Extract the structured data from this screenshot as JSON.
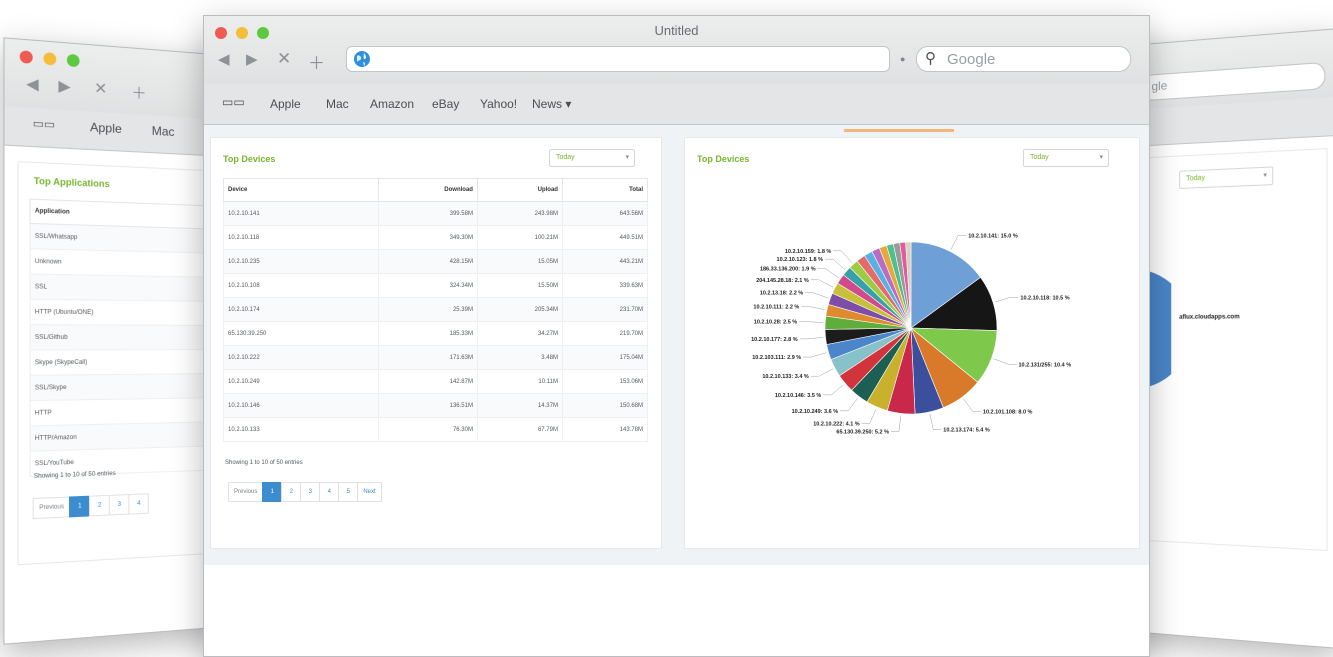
{
  "front": {
    "title": "Untitled",
    "search_placeholder": "Google",
    "bookmarks": [
      "Apple",
      "Mac",
      "Amazon",
      "eBay",
      "Yahoo!",
      "News ▾"
    ],
    "left_panel": {
      "title": "Top Devices",
      "filter": "Today",
      "columns": [
        "Device",
        "Download",
        "Upload",
        "Total"
      ],
      "rows": [
        [
          "10.2.10.141",
          "399.58M",
          "243.98M",
          "643.56M"
        ],
        [
          "10.2.10.118",
          "349.30M",
          "100.21M",
          "449.51M"
        ],
        [
          "10.2.10.235",
          "428.15M",
          "15.05M",
          "443.21M"
        ],
        [
          "10.2.10.108",
          "324.34M",
          "15.50M",
          "339.63M"
        ],
        [
          "10.2.10.174",
          "25.39M",
          "205.34M",
          "231.70M"
        ],
        [
          "65.130.39.250",
          "185.33M",
          "34.27M",
          "219.70M"
        ],
        [
          "10.2.10.222",
          "171.63M",
          "3.48M",
          "175.04M"
        ],
        [
          "10.2.10.249",
          "142.87M",
          "10.11M",
          "153.06M"
        ],
        [
          "10.2.10.146",
          "136.51M",
          "14.37M",
          "150.68M"
        ],
        [
          "10.2.10.133",
          "76.30M",
          "67.79M",
          "143.78M"
        ]
      ],
      "showing": "Showing 1 to 10 of 50 entries",
      "pages": [
        "Previous",
        "1",
        "2",
        "3",
        "4",
        "5",
        "Next"
      ]
    },
    "right_panel": {
      "title": "Top Devices",
      "filter": "Today"
    }
  },
  "left_window": {
    "bookmarks": [
      "Apple",
      "Mac"
    ],
    "panel_title": "Top Applications",
    "column": "Application",
    "rows": [
      "SSL/Whatsapp",
      "Unknown",
      "SSL",
      "HTTP (Ubuntu/ONE)",
      "SSL/Github",
      "Skype (SkypeCall)",
      "SSL/Skype",
      "HTTP",
      "HTTP/Amazon",
      "SSL/YouTube"
    ],
    "showing": "Showing 1 to 10 of 50 entries",
    "pages": [
      "Previous",
      "1",
      "2",
      "3",
      "4"
    ]
  },
  "right_window": {
    "search_fragment": "gle",
    "filter": "Today",
    "pie_label": "aflux.cloudapps.com"
  },
  "chart_data": {
    "type": "pie",
    "slices": [
      {
        "label": "10.2.10.141: 15.0 %",
        "value": 15.0,
        "color": "#6e9fd6"
      },
      {
        "label": "10.2.10.118: 10.5 %",
        "value": 10.5,
        "color": "#161616"
      },
      {
        "label": "10.2.131/255: 10.4 %",
        "value": 10.4,
        "color": "#7ec94b"
      },
      {
        "label": "10.2.101.108: 8.0 %",
        "value": 8.0,
        "color": "#d97a2b"
      },
      {
        "label": "10.2.13.174: 5.4 %",
        "value": 5.4,
        "color": "#3b4f9c"
      },
      {
        "label": "65.130.39.250: 5.2 %",
        "value": 5.2,
        "color": "#c9284a"
      },
      {
        "label": "10.2.10.222: 4.1 %",
        "value": 4.1,
        "color": "#c9b12e"
      },
      {
        "label": "10.2.10.249: 3.6 %",
        "value": 3.6,
        "color": "#1e5f54"
      },
      {
        "label": "10.2.10.146: 3.5 %",
        "value": 3.5,
        "color": "#d2343b"
      },
      {
        "label": "10.2.10.133: 3.4 %",
        "value": 3.4,
        "color": "#86c2c7"
      },
      {
        "label": "10.2.103.111: 2.9 %",
        "value": 2.9,
        "color": "#4a86c9"
      },
      {
        "label": "10.2.10.177: 2.8 %",
        "value": 2.8,
        "color": "#1c1c1c"
      },
      {
        "label": "10.2.10.28: 2.5 %",
        "value": 2.5,
        "color": "#5fae3c"
      },
      {
        "label": "10.2.10.111: 2.2 %",
        "value": 2.2,
        "color": "#e08a2e"
      },
      {
        "label": "10.2.13.18: 2.2 %",
        "value": 2.2,
        "color": "#7c4ea8"
      },
      {
        "label": "204.145.28.18: 2.1 %",
        "value": 2.1,
        "color": "#c8c03a"
      },
      {
        "label": "186.33.136.200: 1.9 %",
        "value": 1.9,
        "color": "#d14a8a"
      },
      {
        "label": "10.2.10.123: 1.8 %",
        "value": 1.8,
        "color": "#3aa0a8"
      },
      {
        "label": "10.2.10.159: 1.8 %",
        "value": 1.8,
        "color": "#9bcc44"
      },
      {
        "label": "",
        "value": 1.7,
        "color": "#e56b6b"
      },
      {
        "label": "",
        "value": 1.6,
        "color": "#5ab0e0"
      },
      {
        "label": "",
        "value": 1.5,
        "color": "#b86cc4"
      },
      {
        "label": "",
        "value": 1.4,
        "color": "#e7a83a"
      },
      {
        "label": "",
        "value": 1.3,
        "color": "#4ec08e"
      },
      {
        "label": "",
        "value": 1.2,
        "color": "#9a9a9a"
      },
      {
        "label": "",
        "value": 1.1,
        "color": "#e05c9c"
      },
      {
        "label": "",
        "value": 1.0,
        "color": "#d8d0c0"
      }
    ]
  }
}
